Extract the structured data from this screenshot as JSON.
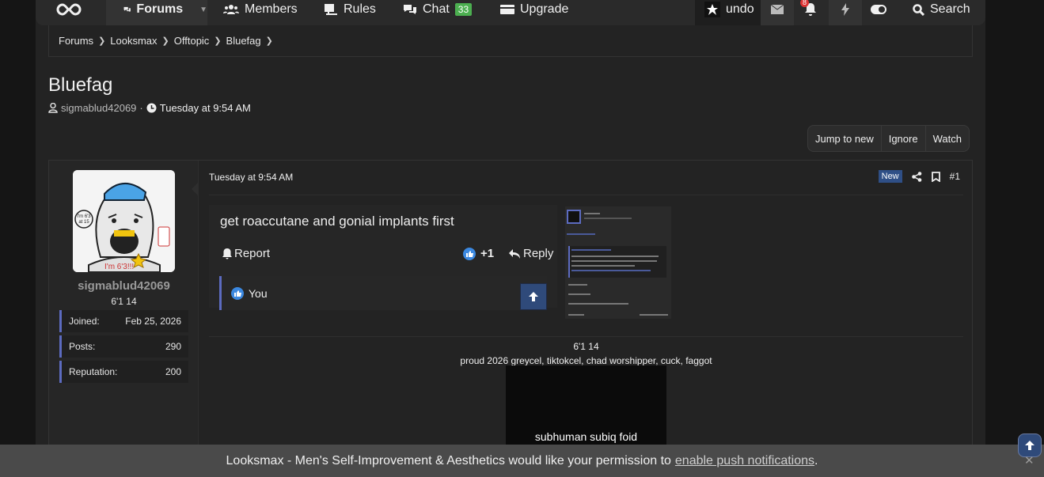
{
  "nav": {
    "forums": "Forums",
    "members": "Members",
    "rules": "Rules",
    "chat": "Chat",
    "chat_badge": "33",
    "upgrade": "Upgrade",
    "user": "undo",
    "alerts_badge": "8",
    "search": "Search"
  },
  "breadcrumb": [
    "Forums",
    "Looksmax",
    "Offtopic",
    "Bluefag"
  ],
  "thread": {
    "title": "Bluefag",
    "author": "sigmablud42069",
    "started": "Tuesday at 9:54 AM"
  },
  "actions": {
    "jump_to_new": "Jump to new",
    "ignore": "Ignore",
    "watch": "Watch"
  },
  "post": {
    "time": "Tuesday at 9:54 AM",
    "new_badge": "New",
    "number": "#1",
    "text": "get roaccutane and gonial implants first",
    "report": "Report",
    "reaction_count": "+1",
    "reply": "Reply",
    "reacted_by": "You"
  },
  "user": {
    "name": "sigmablud42069",
    "title": "6'1 14",
    "joined_label": "Joined:",
    "joined": "Feb 25, 2026",
    "posts_label": "Posts:",
    "posts": "290",
    "reputation_label": "Reputation:",
    "reputation": "200",
    "avatar_text": [
      "I'm 6'3!!!",
      "I'm 6'3 at 15"
    ]
  },
  "signature": {
    "title": "6'1 14",
    "description": "proud 2026 greycel, tiktokcel, chad worshipper, cuck, faggot",
    "image_caption": "subhuman subiq foid"
  },
  "push": {
    "prefix": "Looksmax - Men's Self-Improvement & Aesthetics would like your permission to",
    "link": "enable push notifications",
    "suffix": "."
  },
  "colors": {
    "accent": "#5c6bc0",
    "button_blue": "#2f4a7a",
    "chat_badge": "#4caf50",
    "alert_badge": "#dd3333"
  }
}
